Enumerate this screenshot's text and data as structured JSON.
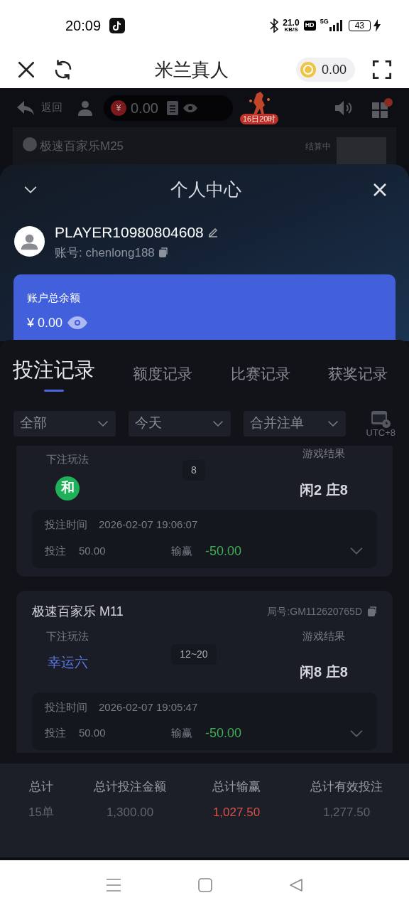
{
  "status_bar": {
    "time": "20:09",
    "speed": "21.0",
    "speed_unit": "KB/S",
    "hd": "HD",
    "network": "5G",
    "battery": "43"
  },
  "app_bar": {
    "title": "米兰真人",
    "coins": "0.00"
  },
  "game": {
    "back": "返回",
    "balance": "0.00",
    "currency": "¥",
    "event_badge": "16日20时",
    "table_name": "极速百家乐M25",
    "table_status": "结算中"
  },
  "panel": {
    "title": "个人中心",
    "player": "PLAYER10980804608",
    "account": "账号: chenlong188",
    "balance_label": "账户总余额",
    "balance": "¥ 0.00"
  },
  "tabs": [
    {
      "label": "投注记录",
      "selected": true
    },
    {
      "label": "额度记录",
      "selected": false
    },
    {
      "label": "比赛记录",
      "selected": false
    },
    {
      "label": "获奖记录",
      "selected": false
    }
  ],
  "filters": [
    {
      "value": "全部"
    },
    {
      "value": "今天"
    },
    {
      "value": "合并注单"
    }
  ],
  "timezone": "UTC+8",
  "records": [
    {
      "bet_label": "下注玩法",
      "bet": "和",
      "kind": "badge",
      "range": "8",
      "result_label": "游戏结果",
      "result": "闲2 庄8",
      "time_label": "投注时间",
      "time": "2026-02-07 19:06:07",
      "stake_label": "投注",
      "stake": "50.00",
      "win_label": "输赢",
      "win": "-50.00"
    },
    {
      "title": "极速百家乐 M11",
      "round": "局号:GM112620765D",
      "bet_label": "下注玩法",
      "bet": "幸运六",
      "kind": "text",
      "range": "12~20",
      "result_label": "游戏结果",
      "result": "闲8 庄8",
      "time_label": "投注时间",
      "time": "2026-02-07 19:05:47",
      "stake_label": "投注",
      "stake": "50.00",
      "win_label": "输赢",
      "win": "-50.00"
    }
  ],
  "totals": [
    {
      "label": "总计",
      "value": "15单",
      "kind": "plain"
    },
    {
      "label": "总计投注金额",
      "value": "1,300.00",
      "kind": "plain"
    },
    {
      "label": "总计输赢",
      "value": "1,027.50",
      "kind": "loss"
    },
    {
      "label": "总计有效投注",
      "value": "1,277.50",
      "kind": "plain"
    }
  ]
}
